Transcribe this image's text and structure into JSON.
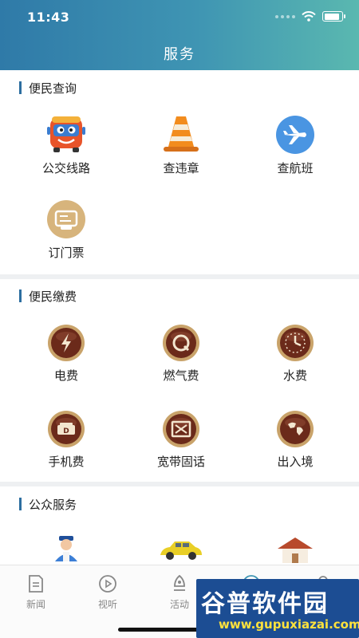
{
  "status_bar": {
    "time": "11:43"
  },
  "header": {
    "title": "服务"
  },
  "sections": [
    {
      "title": "便民查询",
      "items": [
        {
          "label": "公交线路",
          "icon": "bus-icon"
        },
        {
          "label": "查违章",
          "icon": "traffic-cone-icon"
        },
        {
          "label": "查航班",
          "icon": "airplane-icon"
        },
        {
          "label": "订门票",
          "icon": "ticket-icon"
        }
      ]
    },
    {
      "title": "便民缴费",
      "items": [
        {
          "label": "电费",
          "icon": "electricity-icon"
        },
        {
          "label": "燃气费",
          "icon": "gas-icon"
        },
        {
          "label": "水费",
          "icon": "water-clock-icon"
        },
        {
          "label": "手机费",
          "icon": "phone-bill-icon"
        },
        {
          "label": "宽带固话",
          "icon": "broadband-icon"
        },
        {
          "label": "出入境",
          "icon": "globe-icon"
        }
      ]
    },
    {
      "title": "公众服务",
      "items": [
        {
          "label": "",
          "icon": "police-icon"
        },
        {
          "label": "",
          "icon": "taxi-icon"
        },
        {
          "label": "",
          "icon": "house-icon"
        }
      ]
    }
  ],
  "tabbar": {
    "tabs": [
      {
        "label": "新闻",
        "icon": "news-icon"
      },
      {
        "label": "视听",
        "icon": "play-icon"
      },
      {
        "label": "活动",
        "icon": "activity-icon"
      },
      {
        "label": "",
        "icon": "service-icon"
      },
      {
        "label": "",
        "icon": "profile-icon"
      }
    ]
  },
  "watermark": {
    "main": "谷普软件园",
    "sub": "www.gupuxiazai.com"
  },
  "colors": {
    "header_start": "#2f7aa8",
    "header_end": "#5ab8b0",
    "accent_bar": "#2d6ea0",
    "payment_icon_brown": "#6b2a1a",
    "payment_icon_ring": "#c9a36a"
  }
}
